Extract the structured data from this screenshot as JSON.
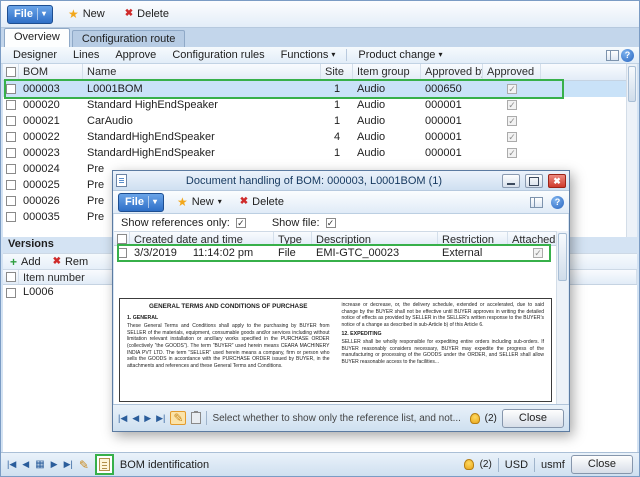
{
  "icons": {
    "caret": "▾",
    "star": "★",
    "x": "✖",
    "check": "✓",
    "pencil": "✎",
    "plus": "+",
    "help": "?",
    "grid": "▦",
    "nav_first": "|◀",
    "nav_prev": "◀",
    "nav_next": "▶",
    "nav_last": "▶|"
  },
  "window": {
    "toolbar": {
      "file": "File",
      "new": "New",
      "delete": "Delete"
    },
    "tabs": [
      {
        "label": "Overview"
      },
      {
        "label": "Configuration route"
      }
    ],
    "actions": [
      {
        "label": "Designer"
      },
      {
        "label": "Lines"
      },
      {
        "label": "Approve"
      },
      {
        "label": "Configuration rules"
      },
      {
        "label": "Functions"
      },
      {
        "label": "Product change"
      }
    ],
    "grid": {
      "headers": {
        "bom": "BOM",
        "name": "Name",
        "site": "Site",
        "item_group": "Item group",
        "approved_by": "Approved by",
        "approved": "Approved"
      },
      "rows": [
        {
          "bom": "000003",
          "name": "L0001BOM",
          "site": "1",
          "item_group": "Audio",
          "approved_by": "000650",
          "approved": "✓"
        },
        {
          "bom": "000020",
          "name": "Standard HighEndSpeaker",
          "site": "1",
          "item_group": "Audio",
          "approved_by": "000001",
          "approved": "✓"
        },
        {
          "bom": "000021",
          "name": "CarAudio",
          "site": "1",
          "item_group": "Audio",
          "approved_by": "000001",
          "approved": "✓"
        },
        {
          "bom": "000022",
          "name": "StandardHighEndSpeaker",
          "site": "4",
          "item_group": "Audio",
          "approved_by": "000001",
          "approved": "✓"
        },
        {
          "bom": "000023",
          "name": "StandardHighEndSpeaker",
          "site": "1",
          "item_group": "Audio",
          "approved_by": "000001",
          "approved": "✓"
        },
        {
          "bom": "000024",
          "name": "Pre"
        },
        {
          "bom": "000025",
          "name": "Pre"
        },
        {
          "bom": "000026",
          "name": "Pre"
        },
        {
          "bom": "000035",
          "name": "Pre"
        }
      ]
    },
    "versions": {
      "title": "Versions",
      "add": "Add",
      "remove": "Rem",
      "header_item_number": "Item number",
      "rows": [
        {
          "item_number": "L0006"
        }
      ]
    },
    "status": {
      "label": "BOM identification",
      "alerts": "(2)",
      "currency": "USD",
      "company": "usmf",
      "close": "Close"
    }
  },
  "dialog": {
    "title": "Document handling of BOM: 000003, L0001BOM (1)",
    "toolbar": {
      "file": "File",
      "new": "New",
      "delete": "Delete"
    },
    "filters": {
      "references": "Show references only:",
      "file": "Show file:"
    },
    "grid": {
      "headers": {
        "created": "Created date and time",
        "type": "Type",
        "description": "Description",
        "restriction": "Restriction",
        "attached": "Attached"
      },
      "rows": [
        {
          "date": "3/3/2019",
          "time": "11:14:02 pm",
          "type": "File",
          "description": "EMI-GTC_00023",
          "restriction": "External",
          "attached": "✓"
        }
      ]
    },
    "document": {
      "title": "GENERAL TERMS AND CONDITIONS OF PURCHASE",
      "s1_head": "1. GENERAL",
      "s1_body": "These General Terms and Conditions shall apply to the purchasing by BUYER from SELLER of the materials, equipment, consumable goods and/or services including without limitation relevant installation or ancillary works specified in the PURCHASE ORDER (collectively “the GOODS”). The term “BUYER” used herein means CEARA MACHINERY INDIA PVT LTD. The term “SELLER” used herein means a company, firm or person who sells the GOODS in accordance with the PURCHASE ORDER issued by BUYER, in the attachments and references and these General Terms and Conditions.",
      "r_body": "increase or decrease, or, the delivery schedule, extended or accelerated, due to said change by the BUYER shall not be effective until BUYER approves in writing the detailed notice of effects as provided by SELLER in the SELLER’s written response to the BUYER’s notice of a change as described in sub-Article b) of this Article 6.",
      "s12_head": "12. EXPEDITING",
      "s12_body": "SELLER shall be wholly responsible for expediting entire orders including sub-orders. If BUYER reasonably considers necessary, BUYER may expedite the progress of the manufacturing or processing of the GOODS under the ORDER, and SELLER shall allow BUYER reasonable access to the facilities..."
    },
    "status": {
      "hint": "Select whether to show only the reference list, and not...",
      "alerts": "(2)",
      "close": "Close"
    }
  }
}
